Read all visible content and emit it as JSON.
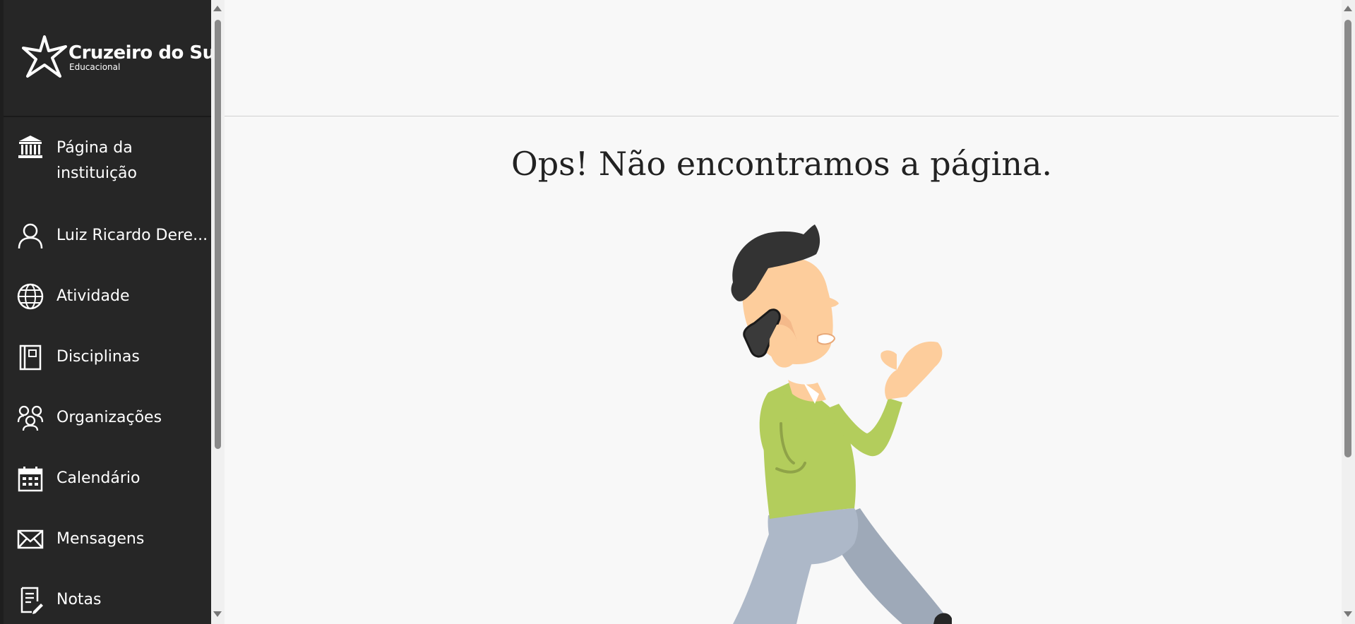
{
  "brand": {
    "name": "Cruzeiro do Sul",
    "subtitle": "Educacional"
  },
  "sidebar": {
    "items": [
      {
        "label": "Página da instituição",
        "icon": "institution-icon"
      },
      {
        "label": "Luiz Ricardo Dere...",
        "icon": "user-icon"
      },
      {
        "label": "Atividade",
        "icon": "globe-icon"
      },
      {
        "label": "Disciplinas",
        "icon": "book-icon"
      },
      {
        "label": "Organizações",
        "icon": "organizations-icon"
      },
      {
        "label": "Calendário",
        "icon": "calendar-icon"
      },
      {
        "label": "Mensagens",
        "icon": "envelope-icon"
      },
      {
        "label": "Notas",
        "icon": "grades-icon"
      }
    ]
  },
  "main": {
    "title": "Ops! Não encontramos a página."
  },
  "colors": {
    "sidebar_bg": "#262626",
    "page_bg": "#f8f8f8",
    "shirt": "#b3cd5c",
    "pants": "#adb8c8",
    "skin": "#fdcd9c",
    "hair": "#333333"
  }
}
